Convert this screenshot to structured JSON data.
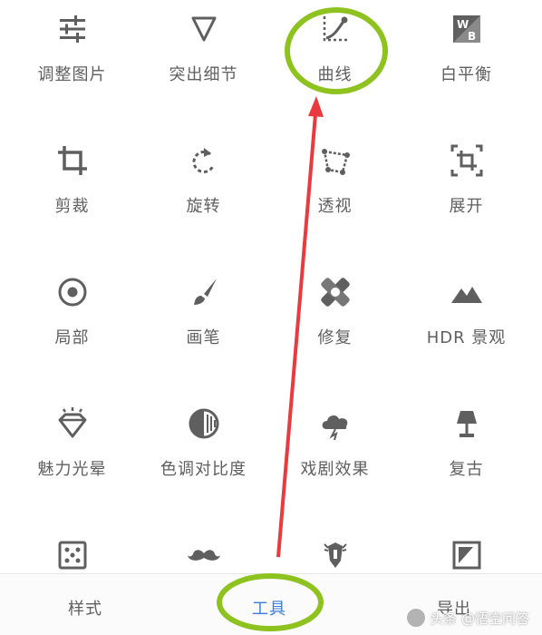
{
  "tools": [
    {
      "label": "调整图片",
      "icon": "sliders-icon"
    },
    {
      "label": "突出细节",
      "icon": "triangle-down-icon"
    },
    {
      "label": "曲线",
      "icon": "curve-icon"
    },
    {
      "label": "白平衡",
      "icon": "white-balance-icon"
    },
    {
      "label": "剪裁",
      "icon": "crop-icon"
    },
    {
      "label": "旋转",
      "icon": "rotate-icon"
    },
    {
      "label": "透视",
      "icon": "perspective-icon"
    },
    {
      "label": "展开",
      "icon": "expand-icon"
    },
    {
      "label": "局部",
      "icon": "selective-icon"
    },
    {
      "label": "画笔",
      "icon": "brush-icon"
    },
    {
      "label": "修复",
      "icon": "healing-icon"
    },
    {
      "label": "HDR 景观",
      "icon": "mountain-icon"
    },
    {
      "label": "魅力光晕",
      "icon": "glamour-glow-icon"
    },
    {
      "label": "色调对比度",
      "icon": "tonal-contrast-icon"
    },
    {
      "label": "戏剧效果",
      "icon": "drama-icon"
    },
    {
      "label": "复古",
      "icon": "vintage-lamp-icon"
    },
    {
      "label": "",
      "icon": "grainy-film-icon"
    },
    {
      "label": "",
      "icon": "mustache-icon"
    },
    {
      "label": "",
      "icon": "grunge-guitar-icon"
    },
    {
      "label": "",
      "icon": "frames-icon"
    }
  ],
  "bottom_tabs": [
    {
      "label": "样式",
      "active": false
    },
    {
      "label": "工具",
      "active": true
    },
    {
      "label": "导出",
      "active": false
    }
  ],
  "watermark": {
    "text": "头条 @悟空问答"
  },
  "colors": {
    "icon": "#5f5f5f",
    "active_tab": "#3b7fd9",
    "highlight_circle": "#8dc21f",
    "arrow": "#e83a3f"
  }
}
